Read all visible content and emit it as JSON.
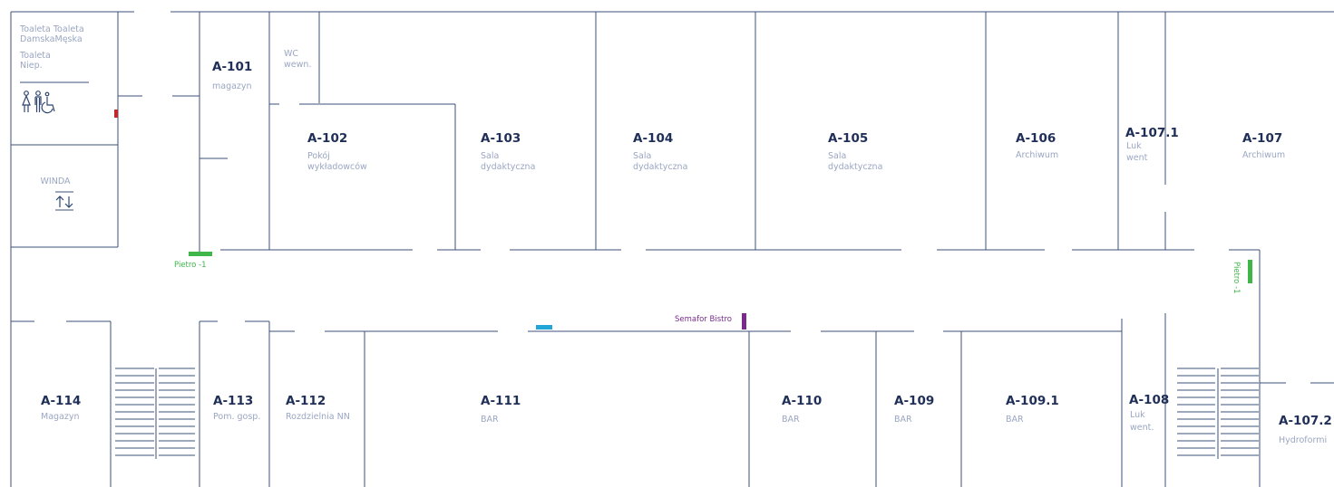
{
  "colors": {
    "wall": "#3d5278",
    "room_code": "#1f2f57",
    "room_desc": "#9aa6c2",
    "stairs_marker": "#3fb54a",
    "bistro_marker": "#7a2a8c",
    "entrance_marker": "#22a6d8",
    "door_marker": "#c4262e"
  },
  "toilets": {
    "label_line1": "Toaleta Toaleta",
    "label_line2": "DamskaMęska",
    "label_line3": "Toaleta",
    "label_line4": "Niep.",
    "icons": [
      "female-icon",
      "male-icon",
      "wheelchair-icon"
    ]
  },
  "elevator": {
    "label": "WINDA",
    "icon": "elevator-arrows-icon"
  },
  "stairs_markers": [
    {
      "label": "Pietro -1"
    },
    {
      "label": "Pietro -1"
    }
  ],
  "bistro": {
    "label": "Semafor Bistro"
  },
  "rooms_top": [
    {
      "code": "A-101",
      "desc": [
        "magazyn"
      ]
    },
    {
      "code": "",
      "desc": [
        "WC",
        "wewn."
      ]
    },
    {
      "code": "A-102",
      "desc": [
        "Pokój",
        "wykładowców"
      ]
    },
    {
      "code": "A-103",
      "desc": [
        "Sala",
        "dydaktyczna"
      ]
    },
    {
      "code": "A-104",
      "desc": [
        "Sala",
        "dydaktyczna"
      ]
    },
    {
      "code": "A-105",
      "desc": [
        "Sala",
        "dydaktyczna"
      ]
    },
    {
      "code": "A-106",
      "desc": [
        "Archiwum"
      ]
    },
    {
      "code": "A-107.1",
      "desc": [
        "Luk",
        "went"
      ]
    },
    {
      "code": "A-107",
      "desc": [
        "Archiwum"
      ]
    }
  ],
  "rooms_bottom": [
    {
      "code": "A-114",
      "desc": [
        "Magazyn"
      ]
    },
    {
      "code": "A-113",
      "desc": [
        "Pom. gosp."
      ]
    },
    {
      "code": "A-112",
      "desc": [
        "Rozdzielnia NN"
      ]
    },
    {
      "code": "A-111",
      "desc": [
        "BAR"
      ]
    },
    {
      "code": "A-110",
      "desc": [
        "BAR"
      ]
    },
    {
      "code": "A-109",
      "desc": [
        "BAR"
      ]
    },
    {
      "code": "A-109.1",
      "desc": [
        "BAR"
      ]
    },
    {
      "code": "A-108",
      "desc": [
        "Luk",
        "went."
      ]
    },
    {
      "code": "A-107.2",
      "desc": [
        "Hydroformi"
      ]
    }
  ]
}
